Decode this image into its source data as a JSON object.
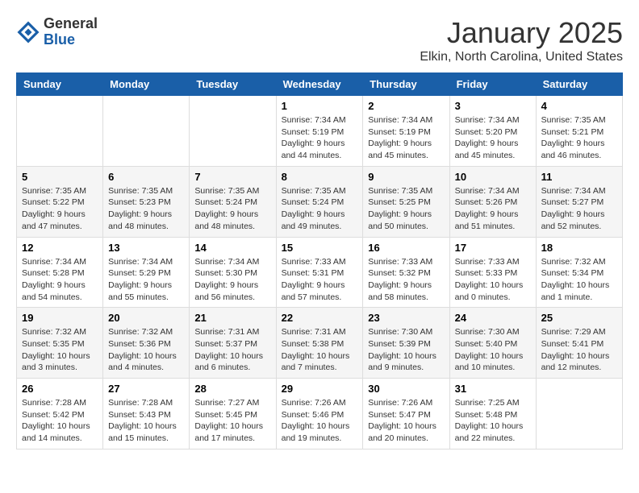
{
  "logo": {
    "general": "General",
    "blue": "Blue"
  },
  "header": {
    "month": "January 2025",
    "location": "Elkin, North Carolina, United States"
  },
  "days_of_week": [
    "Sunday",
    "Monday",
    "Tuesday",
    "Wednesday",
    "Thursday",
    "Friday",
    "Saturday"
  ],
  "weeks": [
    [
      {
        "day": "",
        "info": ""
      },
      {
        "day": "",
        "info": ""
      },
      {
        "day": "",
        "info": ""
      },
      {
        "day": "1",
        "info": "Sunrise: 7:34 AM\nSunset: 5:19 PM\nDaylight: 9 hours and 44 minutes."
      },
      {
        "day": "2",
        "info": "Sunrise: 7:34 AM\nSunset: 5:19 PM\nDaylight: 9 hours and 45 minutes."
      },
      {
        "day": "3",
        "info": "Sunrise: 7:34 AM\nSunset: 5:20 PM\nDaylight: 9 hours and 45 minutes."
      },
      {
        "day": "4",
        "info": "Sunrise: 7:35 AM\nSunset: 5:21 PM\nDaylight: 9 hours and 46 minutes."
      }
    ],
    [
      {
        "day": "5",
        "info": "Sunrise: 7:35 AM\nSunset: 5:22 PM\nDaylight: 9 hours and 47 minutes."
      },
      {
        "day": "6",
        "info": "Sunrise: 7:35 AM\nSunset: 5:23 PM\nDaylight: 9 hours and 48 minutes."
      },
      {
        "day": "7",
        "info": "Sunrise: 7:35 AM\nSunset: 5:24 PM\nDaylight: 9 hours and 48 minutes."
      },
      {
        "day": "8",
        "info": "Sunrise: 7:35 AM\nSunset: 5:24 PM\nDaylight: 9 hours and 49 minutes."
      },
      {
        "day": "9",
        "info": "Sunrise: 7:35 AM\nSunset: 5:25 PM\nDaylight: 9 hours and 50 minutes."
      },
      {
        "day": "10",
        "info": "Sunrise: 7:34 AM\nSunset: 5:26 PM\nDaylight: 9 hours and 51 minutes."
      },
      {
        "day": "11",
        "info": "Sunrise: 7:34 AM\nSunset: 5:27 PM\nDaylight: 9 hours and 52 minutes."
      }
    ],
    [
      {
        "day": "12",
        "info": "Sunrise: 7:34 AM\nSunset: 5:28 PM\nDaylight: 9 hours and 54 minutes."
      },
      {
        "day": "13",
        "info": "Sunrise: 7:34 AM\nSunset: 5:29 PM\nDaylight: 9 hours and 55 minutes."
      },
      {
        "day": "14",
        "info": "Sunrise: 7:34 AM\nSunset: 5:30 PM\nDaylight: 9 hours and 56 minutes."
      },
      {
        "day": "15",
        "info": "Sunrise: 7:33 AM\nSunset: 5:31 PM\nDaylight: 9 hours and 57 minutes."
      },
      {
        "day": "16",
        "info": "Sunrise: 7:33 AM\nSunset: 5:32 PM\nDaylight: 9 hours and 58 minutes."
      },
      {
        "day": "17",
        "info": "Sunrise: 7:33 AM\nSunset: 5:33 PM\nDaylight: 10 hours and 0 minutes."
      },
      {
        "day": "18",
        "info": "Sunrise: 7:32 AM\nSunset: 5:34 PM\nDaylight: 10 hours and 1 minute."
      }
    ],
    [
      {
        "day": "19",
        "info": "Sunrise: 7:32 AM\nSunset: 5:35 PM\nDaylight: 10 hours and 3 minutes."
      },
      {
        "day": "20",
        "info": "Sunrise: 7:32 AM\nSunset: 5:36 PM\nDaylight: 10 hours and 4 minutes."
      },
      {
        "day": "21",
        "info": "Sunrise: 7:31 AM\nSunset: 5:37 PM\nDaylight: 10 hours and 6 minutes."
      },
      {
        "day": "22",
        "info": "Sunrise: 7:31 AM\nSunset: 5:38 PM\nDaylight: 10 hours and 7 minutes."
      },
      {
        "day": "23",
        "info": "Sunrise: 7:30 AM\nSunset: 5:39 PM\nDaylight: 10 hours and 9 minutes."
      },
      {
        "day": "24",
        "info": "Sunrise: 7:30 AM\nSunset: 5:40 PM\nDaylight: 10 hours and 10 minutes."
      },
      {
        "day": "25",
        "info": "Sunrise: 7:29 AM\nSunset: 5:41 PM\nDaylight: 10 hours and 12 minutes."
      }
    ],
    [
      {
        "day": "26",
        "info": "Sunrise: 7:28 AM\nSunset: 5:42 PM\nDaylight: 10 hours and 14 minutes."
      },
      {
        "day": "27",
        "info": "Sunrise: 7:28 AM\nSunset: 5:43 PM\nDaylight: 10 hours and 15 minutes."
      },
      {
        "day": "28",
        "info": "Sunrise: 7:27 AM\nSunset: 5:45 PM\nDaylight: 10 hours and 17 minutes."
      },
      {
        "day": "29",
        "info": "Sunrise: 7:26 AM\nSunset: 5:46 PM\nDaylight: 10 hours and 19 minutes."
      },
      {
        "day": "30",
        "info": "Sunrise: 7:26 AM\nSunset: 5:47 PM\nDaylight: 10 hours and 20 minutes."
      },
      {
        "day": "31",
        "info": "Sunrise: 7:25 AM\nSunset: 5:48 PM\nDaylight: 10 hours and 22 minutes."
      },
      {
        "day": "",
        "info": ""
      }
    ]
  ]
}
